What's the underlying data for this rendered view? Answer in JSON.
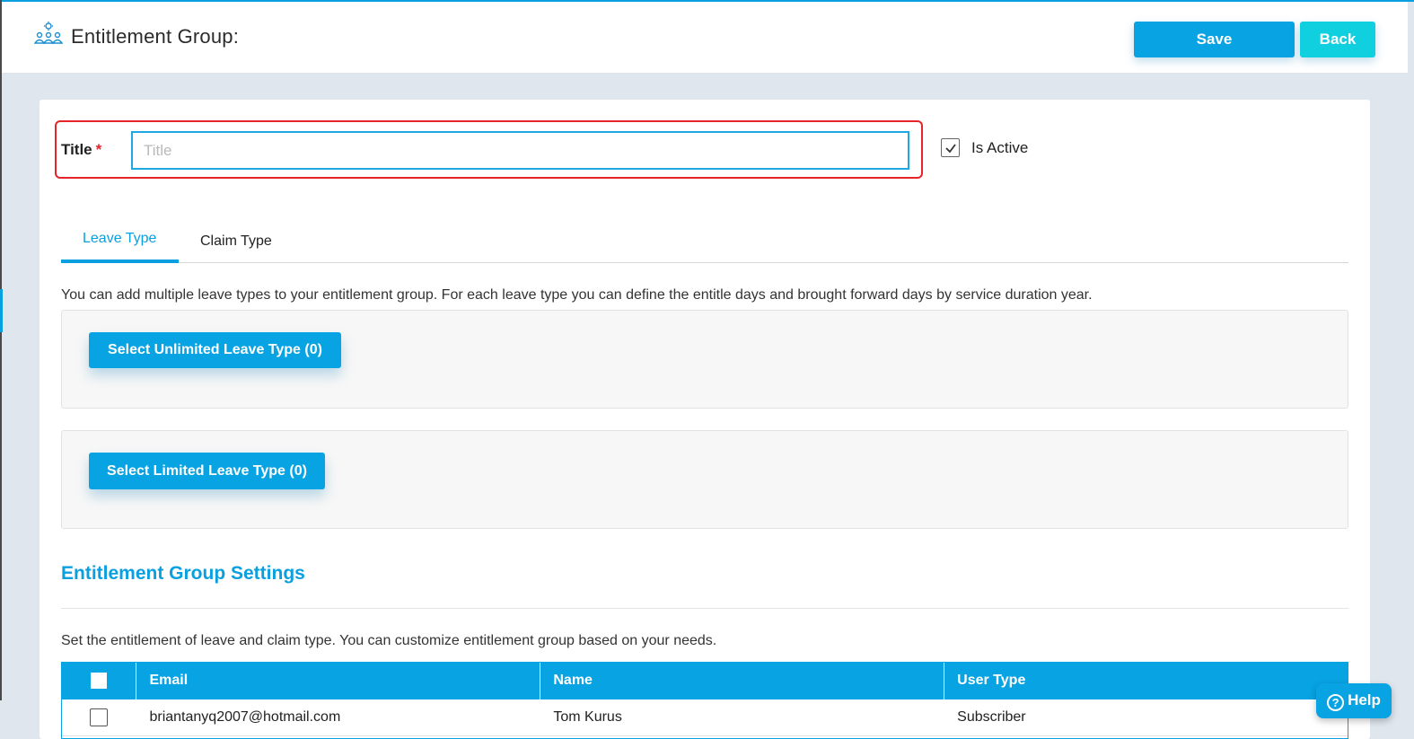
{
  "header": {
    "title": "Entitlement Group:",
    "icon": "user-group-settings-icon",
    "save_label": "Save",
    "back_label": "Back"
  },
  "form": {
    "title_label": "Title",
    "required_marker": "*",
    "title_placeholder": "Title",
    "title_value": "",
    "is_active_label": "Is Active",
    "is_active_checked": true
  },
  "tabs": [
    {
      "label": "Leave Type",
      "active": true
    },
    {
      "label": "Claim Type",
      "active": false
    }
  ],
  "leave_section": {
    "description": "You can add multiple leave types to your entitlement group. For each leave type you can define the entitle days and brought forward days by service duration year.",
    "unlimited_button": "Select Unlimited Leave Type (0)",
    "limited_button": "Select Limited Leave Type (0)"
  },
  "settings": {
    "title": "Entitlement Group Settings",
    "description": "Set the entitlement of leave and claim type. You can customize entitlement group based on your needs."
  },
  "table": {
    "columns": [
      "",
      "Email",
      "Name",
      "User Type"
    ],
    "rows": [
      {
        "email": "briantanyq2007@hotmail.com",
        "name": "Tom Kurus",
        "user_type": "Subscriber",
        "checked": false
      }
    ]
  },
  "help": {
    "label": "Help",
    "glyph": "?"
  },
  "colors": {
    "primary": "#07a3e3",
    "accent_cyan": "#10d0e0",
    "highlight_red": "#e5252a",
    "background": "#dfe6ee"
  }
}
